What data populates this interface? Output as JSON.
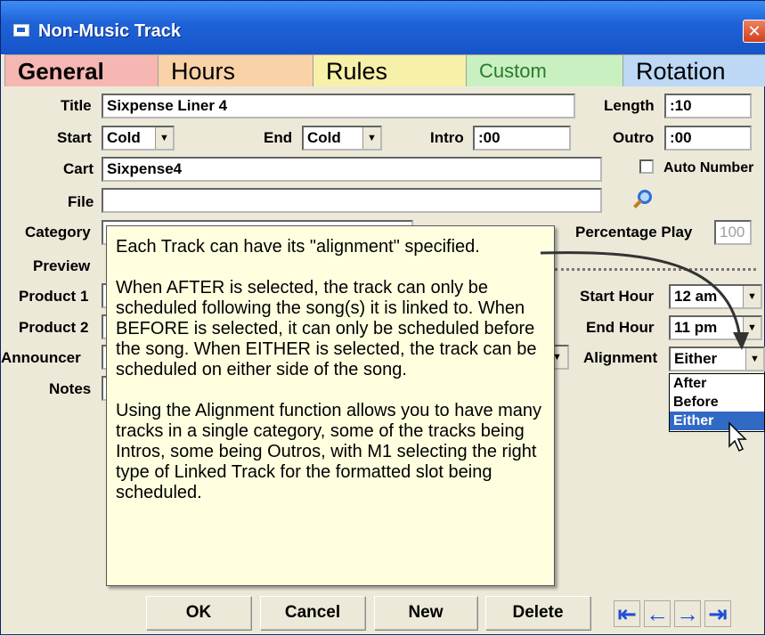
{
  "window": {
    "title": "Non-Music Track",
    "close_glyph": "✕"
  },
  "tabs": [
    {
      "label": "General"
    },
    {
      "label": "Hours"
    },
    {
      "label": "Rules"
    },
    {
      "label": "Custom"
    },
    {
      "label": "Rotation"
    }
  ],
  "form": {
    "title_label": "Title",
    "title_value": "Sixpense Liner 4",
    "length_label": "Length",
    "length_value": ":10",
    "start_label": "Start",
    "start_value": "Cold",
    "end_label": "End",
    "end_value": "Cold",
    "intro_label": "Intro",
    "intro_value": ":00",
    "outro_label": "Outro",
    "outro_value": ":00",
    "cart_label": "Cart",
    "cart_value": "Sixpense4",
    "auto_number_label": "Auto Number",
    "file_label": "File",
    "file_value": "",
    "category_label": "Category",
    "percentage_play_label": "Percentage Play",
    "percentage_play_value": "100",
    "preview_label": "Preview",
    "product1_label": "Product 1",
    "product2_label": "Product 2",
    "announcer_label": "Announcer",
    "notes_label": "Notes",
    "start_hour_label": "Start Hour",
    "start_hour_value": "12 am",
    "end_hour_label": "End Hour",
    "end_hour_value": "11 pm",
    "alignment_label": "Alignment",
    "alignment_value": "Either",
    "alignment_options": [
      "After",
      "Before",
      "Either"
    ]
  },
  "callout": {
    "p1": "Each Track can have its \"alignment\" specified.",
    "p2": "When AFTER is selected, the track can only be scheduled following the song(s) it is linked to.   When BEFORE is selected, it can only be scheduled before the song.  When EITHER is selected, the track can be scheduled on either side of the song.",
    "p3": "Using the Alignment function allows you to have many tracks in a single category, some of the tracks being Intros, some being Outros, with M1 selecting the right type of Linked Track for the formatted slot being scheduled."
  },
  "buttons": {
    "ok": "OK",
    "cancel": "Cancel",
    "new": "New",
    "delete": "Delete"
  },
  "nav": {
    "first": "⇤",
    "prev": "←",
    "next": "→",
    "last": "⇥"
  }
}
